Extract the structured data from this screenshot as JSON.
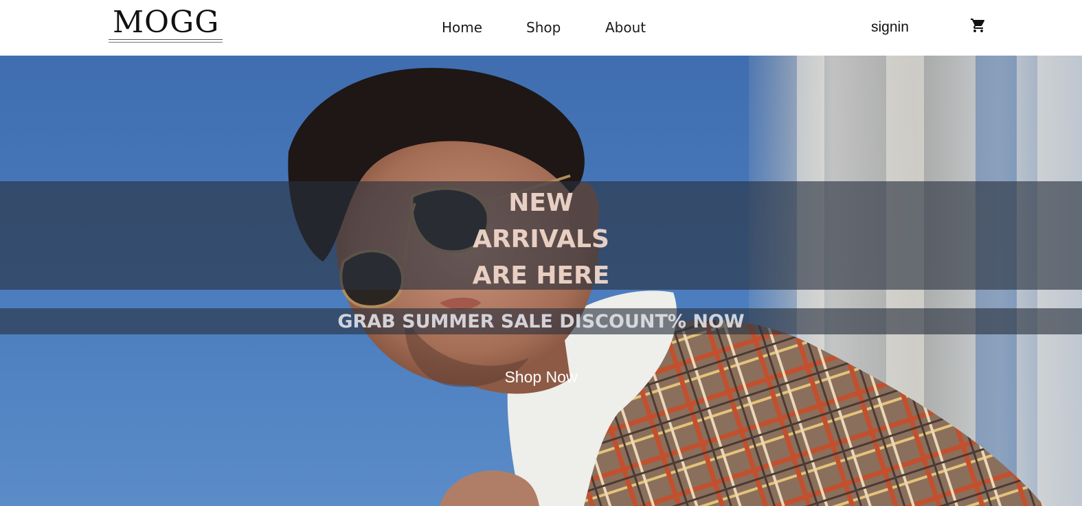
{
  "header": {
    "logo_text": "MOGG",
    "nav": {
      "home": "Home",
      "shop": "Shop",
      "about": "About"
    },
    "signin": "signin",
    "cart_icon": "cart-icon"
  },
  "hero": {
    "headline": [
      "NEW",
      "ARRIVALS",
      "ARE HERE"
    ],
    "subline": "GRAB SUMMER SALE DISCOUNT% NOW",
    "cta": "Shop Now",
    "image": "man-in-sunglasses-and-plaid-jacket-photo"
  },
  "colors": {
    "header_bg": "#ffffff",
    "sky": "#4a78b8",
    "overlay": "#28303e",
    "headline_text": "#f5dacd",
    "subline_text": "#e1e1e8"
  }
}
